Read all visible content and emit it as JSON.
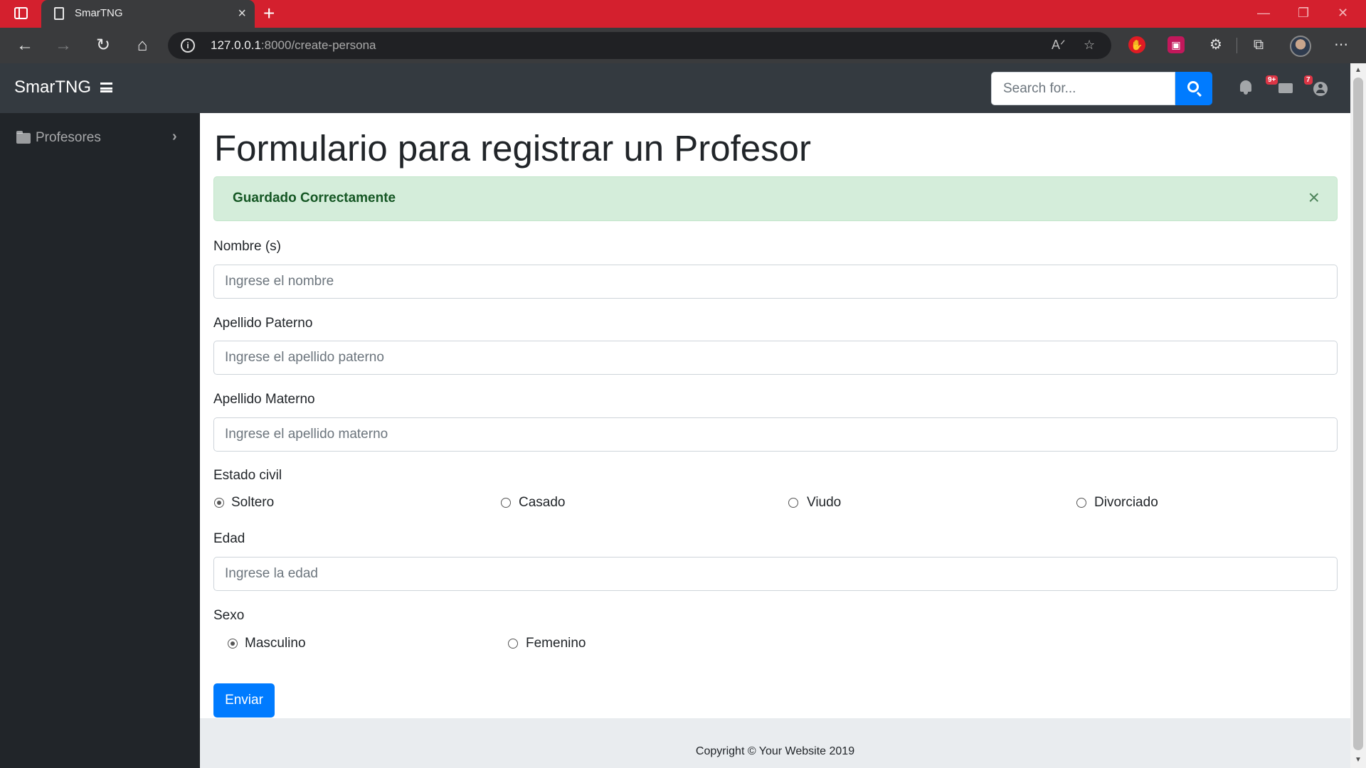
{
  "browser": {
    "tab_title": "SmarTNG",
    "url_host": "127.0.0.1",
    "url_path": ":8000/create-persona",
    "tab_close": "×",
    "new_tab": "+"
  },
  "app": {
    "brand": "SmarTNG",
    "search_placeholder": "Search for...",
    "alerts_badge": "9+",
    "messages_badge": "7"
  },
  "sidebar": {
    "items": [
      {
        "label": "Profesores"
      }
    ]
  },
  "form": {
    "title": "Formulario para registrar un Profesor",
    "alert_text": "Guardado Correctamente",
    "alert_close": "×",
    "nombre_label": "Nombre (s)",
    "nombre_placeholder": "Ingrese el nombre",
    "paterno_label": "Apellido Paterno",
    "paterno_placeholder": "Ingrese el apellido paterno",
    "materno_label": "Apellido Materno",
    "materno_placeholder": "Ingrese el apellido materno",
    "estado_label": "Estado civil",
    "estado_options": [
      "Soltero",
      "Casado",
      "Viudo",
      "Divorciado"
    ],
    "estado_selected": "Soltero",
    "edad_label": "Edad",
    "edad_placeholder": "Ingrese la edad",
    "sexo_label": "Sexo",
    "sexo_options": [
      "Masculino",
      "Femenino"
    ],
    "sexo_selected": "Masculino",
    "submit_label": "Enviar"
  },
  "footer": {
    "text": "Copyright © Your Website 2019"
  },
  "colors": {
    "tabbar": "#d4202e",
    "navbar": "#343a40",
    "sidebar": "#212529",
    "primary": "#007bff",
    "alert_bg": "#d4edda",
    "alert_text": "#155724"
  }
}
